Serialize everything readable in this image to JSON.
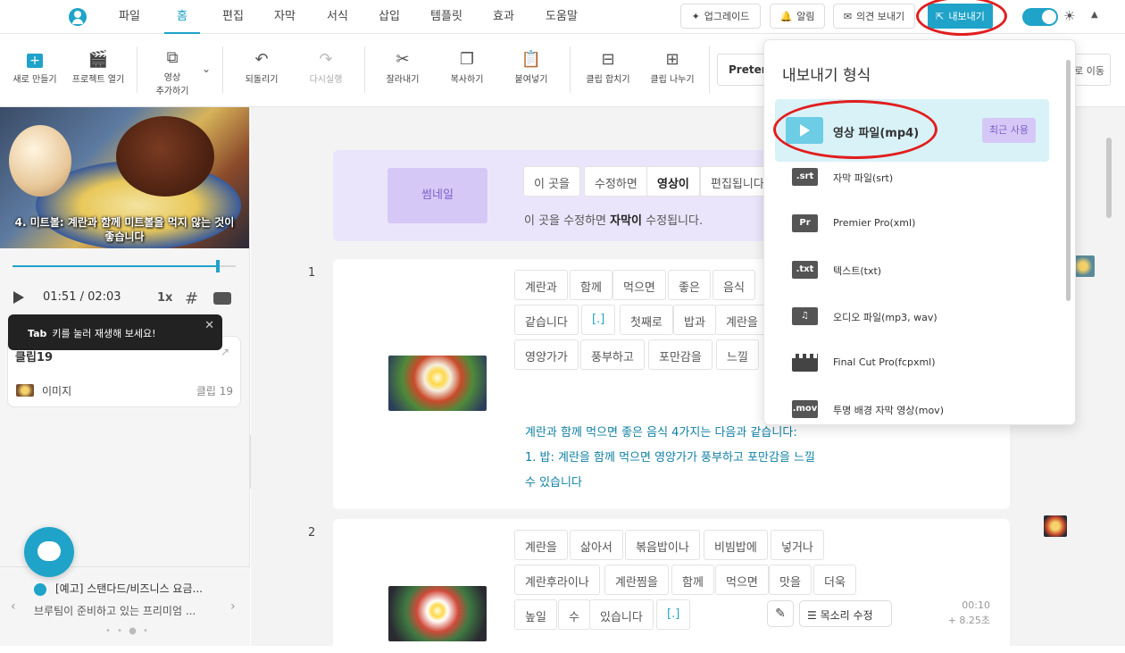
{
  "menu": {
    "items": [
      "파일",
      "홈",
      "편집",
      "자막",
      "서식",
      "삽입",
      "템플릿",
      "효과",
      "도움말"
    ],
    "active": "홈"
  },
  "topbuttons": {
    "upgrade": "업그레이드",
    "notify": "알림",
    "feedback": "의견 보내기",
    "export": "내보내기"
  },
  "toolbar": {
    "new": "새로 만들기",
    "open": "프로젝트 열기",
    "add_video_1": "영상",
    "add_video_2": "추가하기",
    "undo": "되돌리기",
    "redo": "다시실행",
    "cut": "잘라내기",
    "copy": "복사하기",
    "paste": "붙여넣기",
    "merge": "클립 합치기",
    "split": "클립 나누기",
    "font": "Pretend",
    "move": "로 이동"
  },
  "preview": {
    "caption_line1": "4.  미트볼: 계란과 함께 미트볼을 먹지 않는 것이",
    "caption_line2": "좋습니다",
    "progress": 0.92,
    "time": "01:51 / 02:03",
    "speed": "1x"
  },
  "tooltip": {
    "key": "Tab",
    "text": "키를 눌러 재생해 보세요!"
  },
  "clip_card": {
    "title": "클립19",
    "kind": "이미지",
    "number": "클립 19"
  },
  "news": {
    "title": "[예고] 스탠다드/비즈니스 요금...",
    "body": "브루팀이 준비하고 있는 프리미엄 ..."
  },
  "thumbnail_row": {
    "label": "썸네일",
    "chips": [
      "이 곳을",
      "수정하면",
      "영상이",
      "편집됩니다"
    ],
    "instruction_pre": "이 곳을 수정하면",
    "instruction_bold": "자막이",
    "instruction_post": "수정됩니다."
  },
  "rows": [
    {
      "number": "1",
      "chips_line1": [
        "계란과",
        "함께",
        "먹으면",
        "좋은",
        "음식"
      ],
      "chips_line2": [
        "같습니다",
        "[.]",
        "첫째로",
        "밥과",
        "계란을"
      ],
      "chips_line3": [
        "영양가가",
        "풍부하고",
        "포만감을",
        "느낄"
      ],
      "paragraph": [
        "계란과 함께 먹으면 좋은 음식 4가지는 다음과 같습니다:",
        "1.   밥: 계란을 함께 먹으면 영양가가 풍부하고 포만감을 느낄",
        "수 있습니다"
      ]
    },
    {
      "number": "2",
      "chips_line1": [
        "계란을",
        "삶아서",
        "볶음밥이나",
        "비빔밥에",
        "넣거나"
      ],
      "chips_line2": [
        "계란후라이나",
        "계란찜을",
        "함께",
        "먹으면",
        "맛을",
        "더욱"
      ],
      "chips_line3": [
        "높일",
        "수",
        "있습니다",
        "[.]"
      ],
      "time": "00:10",
      "duration": "+ 8.25초",
      "voice": "목소리 수정"
    }
  ],
  "export_menu": {
    "title": "내보내기 형식",
    "items": [
      {
        "icon": "",
        "label": "영상 파일(mp4)",
        "badge": "최근 사용"
      },
      {
        "icon": ".srt",
        "label": "자막 파일(srt)"
      },
      {
        "icon": "Pr",
        "label": "Premier Pro(xml)"
      },
      {
        "icon": ".txt",
        "label": "텍스트(txt)"
      },
      {
        "icon": "♫",
        "label": "오디오 파일(mp3, wav)"
      },
      {
        "icon": "",
        "label": "Final Cut Pro(fcpxml)"
      },
      {
        "icon": ".mov",
        "label": "투명 배경 자막 영상(mov)"
      }
    ]
  },
  "colors": {
    "accent": "#1fa3c9",
    "annotation": "#e21d1d",
    "thumbnail_bg": "#ebe5fb"
  }
}
